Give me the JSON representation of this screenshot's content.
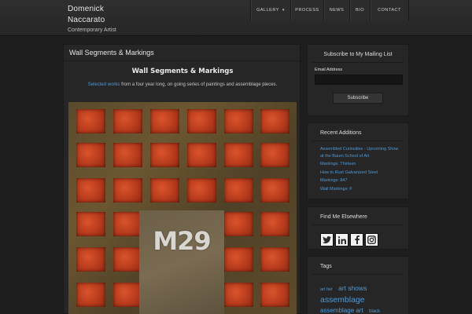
{
  "site": {
    "title": "Domenick Naccarato",
    "tagline": "Contemporary Artist"
  },
  "nav": [
    {
      "label": "GALLERY",
      "caret": "▾"
    },
    {
      "label": "PROCESS"
    },
    {
      "label": "NEWS"
    },
    {
      "label": "BIO"
    },
    {
      "label": "CONTACT"
    }
  ],
  "main": {
    "header_title": "Wall Segments & Markings",
    "article_title": "Wall Segments & Markings",
    "intro_link": "Selected works",
    "intro_text": " from a four year long, on going series of paintings and assemblage pieces.",
    "painting_text": "M29"
  },
  "sidebar": {
    "mailing": {
      "title": "Subscribe to My Mailing List",
      "email_label": "Email Address",
      "email_placeholder": "",
      "subscribe_label": "Subscribe"
    },
    "recent": {
      "title": "Recent Additions",
      "items": [
        "Assembled Curiosities - Upcoming Show at the Baum School of Art",
        "Markings: Thirteen",
        "How to Rust Galvanized Steel",
        "Markings: 847",
        "Wall Markings: F"
      ]
    },
    "elsewhere": {
      "title": "Find Me Elsewhere",
      "icons": [
        "twitter-icon",
        "linkedin-icon",
        "facebook-icon",
        "instagram-icon"
      ]
    },
    "tags": {
      "title": "Tags",
      "items": [
        "art fair",
        "art shows",
        "assemblage",
        "assemblage art",
        "black"
      ]
    }
  },
  "colors": {
    "link": "#4e9ad7",
    "background": "#1e1e1e",
    "panel": "#262626"
  }
}
